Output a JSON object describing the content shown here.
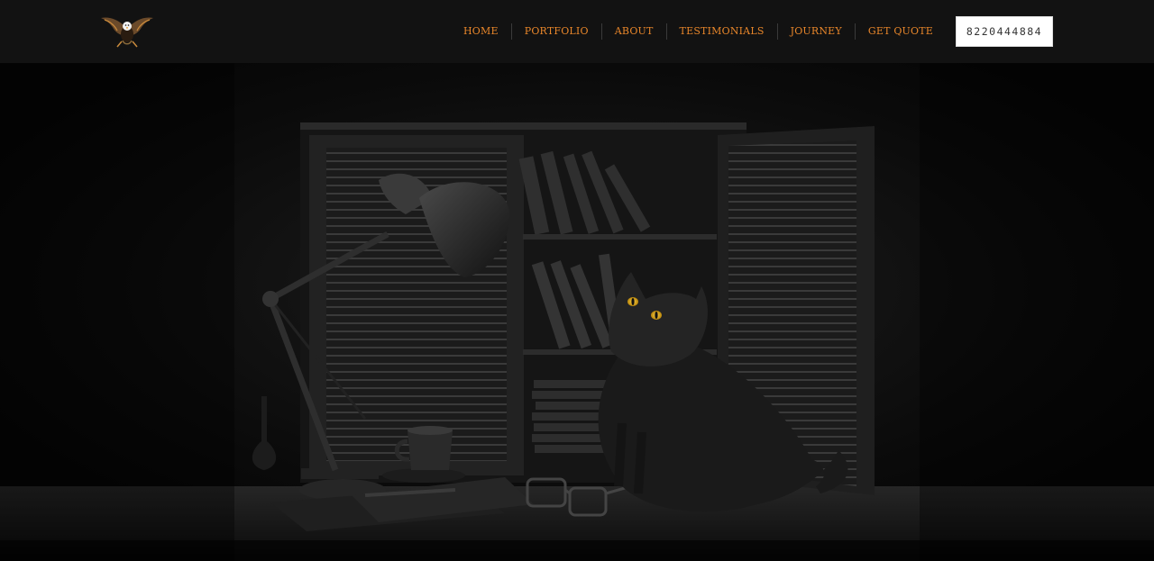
{
  "nav": {
    "items": [
      "HOME",
      "PORTFOLIO",
      "ABOUT",
      "TESTIMONIALS",
      "JOURNEY",
      "GET QUOTE"
    ]
  },
  "phone": {
    "label": "8220444884"
  },
  "colors": {
    "accent": "#e8862a",
    "navbar": "#121212",
    "background": "#000000"
  },
  "icons": {
    "logo": "eagle-icon"
  },
  "hero": {
    "image": "black cat beside desk lamp and shuttered bookcase"
  }
}
